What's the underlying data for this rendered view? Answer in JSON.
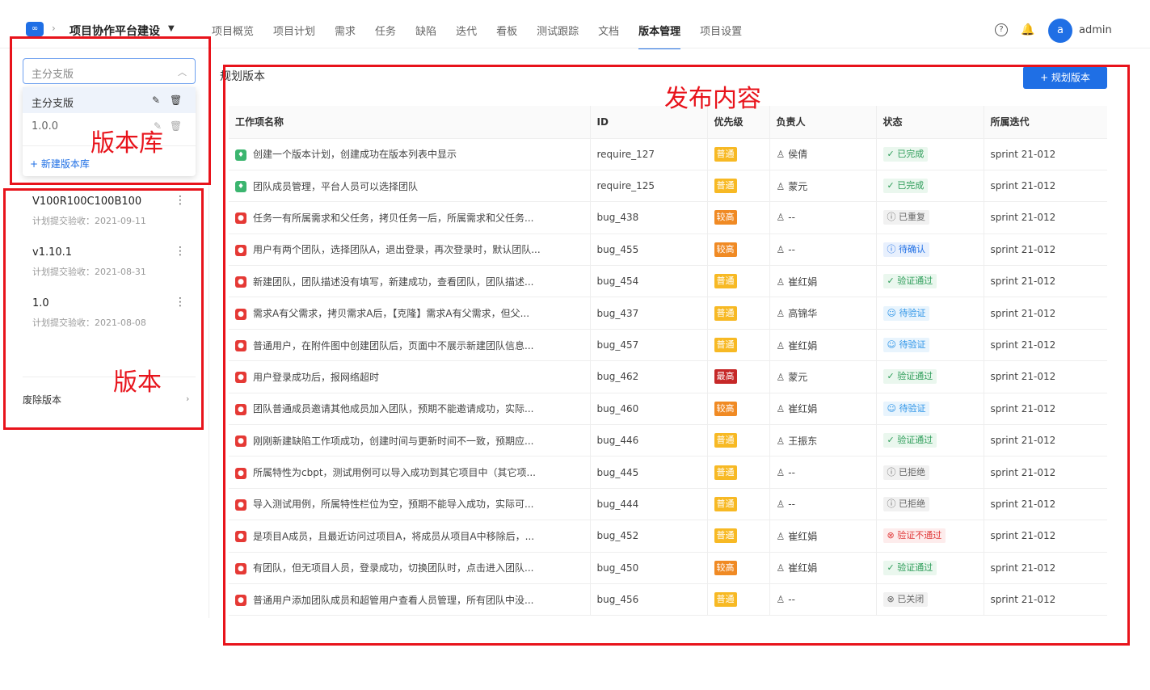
{
  "header": {
    "project_name": "项目协作平台建设",
    "nav": [
      "项目概览",
      "项目计划",
      "需求",
      "任务",
      "缺陷",
      "迭代",
      "看板",
      "测试跟踪",
      "文档",
      "版本管理",
      "项目设置"
    ],
    "active_nav": "版本管理",
    "user_initial": "a",
    "user_name": "admin"
  },
  "sidebar": {
    "branch_select": "主分支版",
    "branch_options": [
      {
        "label": "主分支版"
      },
      {
        "label": "1.0.0"
      }
    ],
    "new_repo_label": "+ 新建版本库",
    "versions": [
      {
        "name": "V100R100C100B100",
        "sub": "计划提交验收：2021-09-11"
      },
      {
        "name": "v1.10.1",
        "sub": "计划提交验收：2021-08-31"
      },
      {
        "name": "1.0",
        "sub": "计划提交验收：2021-08-08"
      }
    ],
    "deprecated_label": "废除版本"
  },
  "annotations": {
    "repo": "版本库",
    "version": "版本",
    "content": "发布内容"
  },
  "main": {
    "section_title": "规划版本",
    "plan_button": "+ 规划版本",
    "columns": [
      "工作项名称",
      "ID",
      "优先级",
      "负责人",
      "状态",
      "所属迭代"
    ],
    "rows": [
      {
        "type": "req",
        "name": "创建一个版本计划，创建成功在版本列表中显示",
        "id": "require_127",
        "prio": "普通",
        "prio_level": "normal",
        "owner": "侯倩",
        "status": "已完成",
        "status_kind": "done",
        "iter": "sprint 21-012"
      },
      {
        "type": "req",
        "name": "团队成员管理，平台人员可以选择团队",
        "id": "require_125",
        "prio": "普通",
        "prio_level": "normal",
        "owner": "蒙元",
        "status": "已完成",
        "status_kind": "done",
        "iter": "sprint 21-012"
      },
      {
        "type": "bug",
        "name": "任务一有所属需求和父任务，拷贝任务一后，所属需求和父任务...",
        "id": "bug_438",
        "prio": "较高",
        "prio_level": "high",
        "owner": "--",
        "status": "已重复",
        "status_kind": "grey",
        "iter": "sprint 21-012"
      },
      {
        "type": "bug",
        "name": "用户有两个团队，选择团队A，退出登录，再次登录时，默认团队...",
        "id": "bug_455",
        "prio": "较高",
        "prio_level": "high",
        "owner": "--",
        "status": "待确认",
        "status_kind": "blue",
        "iter": "sprint 21-012"
      },
      {
        "type": "bug",
        "name": "新建团队，团队描述没有填写，新建成功，查看团队，团队描述...",
        "id": "bug_454",
        "prio": "普通",
        "prio_level": "normal",
        "owner": "崔红娟",
        "status": "验证通过",
        "status_kind": "done",
        "iter": "sprint 21-012"
      },
      {
        "type": "bug",
        "name": "需求A有父需求，拷贝需求A后，【克隆】需求A有父需求，但父...",
        "id": "bug_437",
        "prio": "普通",
        "prio_level": "normal",
        "owner": "高锦华",
        "status": "待验证",
        "status_kind": "light",
        "iter": "sprint 21-012"
      },
      {
        "type": "bug",
        "name": "普通用户，在附件图中创建团队后，页面中不展示新建团队信息...",
        "id": "bug_457",
        "prio": "普通",
        "prio_level": "normal",
        "owner": "崔红娟",
        "status": "待验证",
        "status_kind": "light",
        "iter": "sprint 21-012"
      },
      {
        "type": "bug",
        "name": "用户登录成功后，报网络超时",
        "id": "bug_462",
        "prio": "最高",
        "prio_level": "highest",
        "owner": "蒙元",
        "status": "验证通过",
        "status_kind": "done",
        "iter": "sprint 21-012"
      },
      {
        "type": "bug",
        "name": "团队普通成员邀请其他成员加入团队，预期不能邀请成功，实际...",
        "id": "bug_460",
        "prio": "较高",
        "prio_level": "high",
        "owner": "崔红娟",
        "status": "待验证",
        "status_kind": "light",
        "iter": "sprint 21-012"
      },
      {
        "type": "bug",
        "name": "刚刚新建缺陷工作项成功，创建时间与更新时间不一致，预期应...",
        "id": "bug_446",
        "prio": "普通",
        "prio_level": "normal",
        "owner": "王振东",
        "status": "验证通过",
        "status_kind": "done",
        "iter": "sprint 21-012"
      },
      {
        "type": "bug",
        "name": "所属特性为cbpt，测试用例可以导入成功到其它项目中（其它项...",
        "id": "bug_445",
        "prio": "普通",
        "prio_level": "normal",
        "owner": "--",
        "status": "已拒绝",
        "status_kind": "grey",
        "iter": "sprint 21-012"
      },
      {
        "type": "bug",
        "name": "导入测试用例，所属特性栏位为空，预期不能导入成功，实际可...",
        "id": "bug_444",
        "prio": "普通",
        "prio_level": "normal",
        "owner": "--",
        "status": "已拒绝",
        "status_kind": "grey",
        "iter": "sprint 21-012"
      },
      {
        "type": "bug",
        "name": "是项目A成员，且最近访问过项目A，将成员从项目A中移除后，...",
        "id": "bug_452",
        "prio": "普通",
        "prio_level": "normal",
        "owner": "崔红娟",
        "status": "验证不通过",
        "status_kind": "fail",
        "iter": "sprint 21-012"
      },
      {
        "type": "bug",
        "name": "有团队，但无项目人员，登录成功，切换团队时，点击进入团队...",
        "id": "bug_450",
        "prio": "较高",
        "prio_level": "high",
        "owner": "崔红娟",
        "status": "验证通过",
        "status_kind": "done",
        "iter": "sprint 21-012"
      },
      {
        "type": "bug",
        "name": "普通用户添加团队成员和超管用户查看人员管理，所有团队中没...",
        "id": "bug_456",
        "prio": "普通",
        "prio_level": "normal",
        "owner": "--",
        "status": "已关闭",
        "status_kind": "grey",
        "iter": "sprint 21-012"
      }
    ]
  }
}
